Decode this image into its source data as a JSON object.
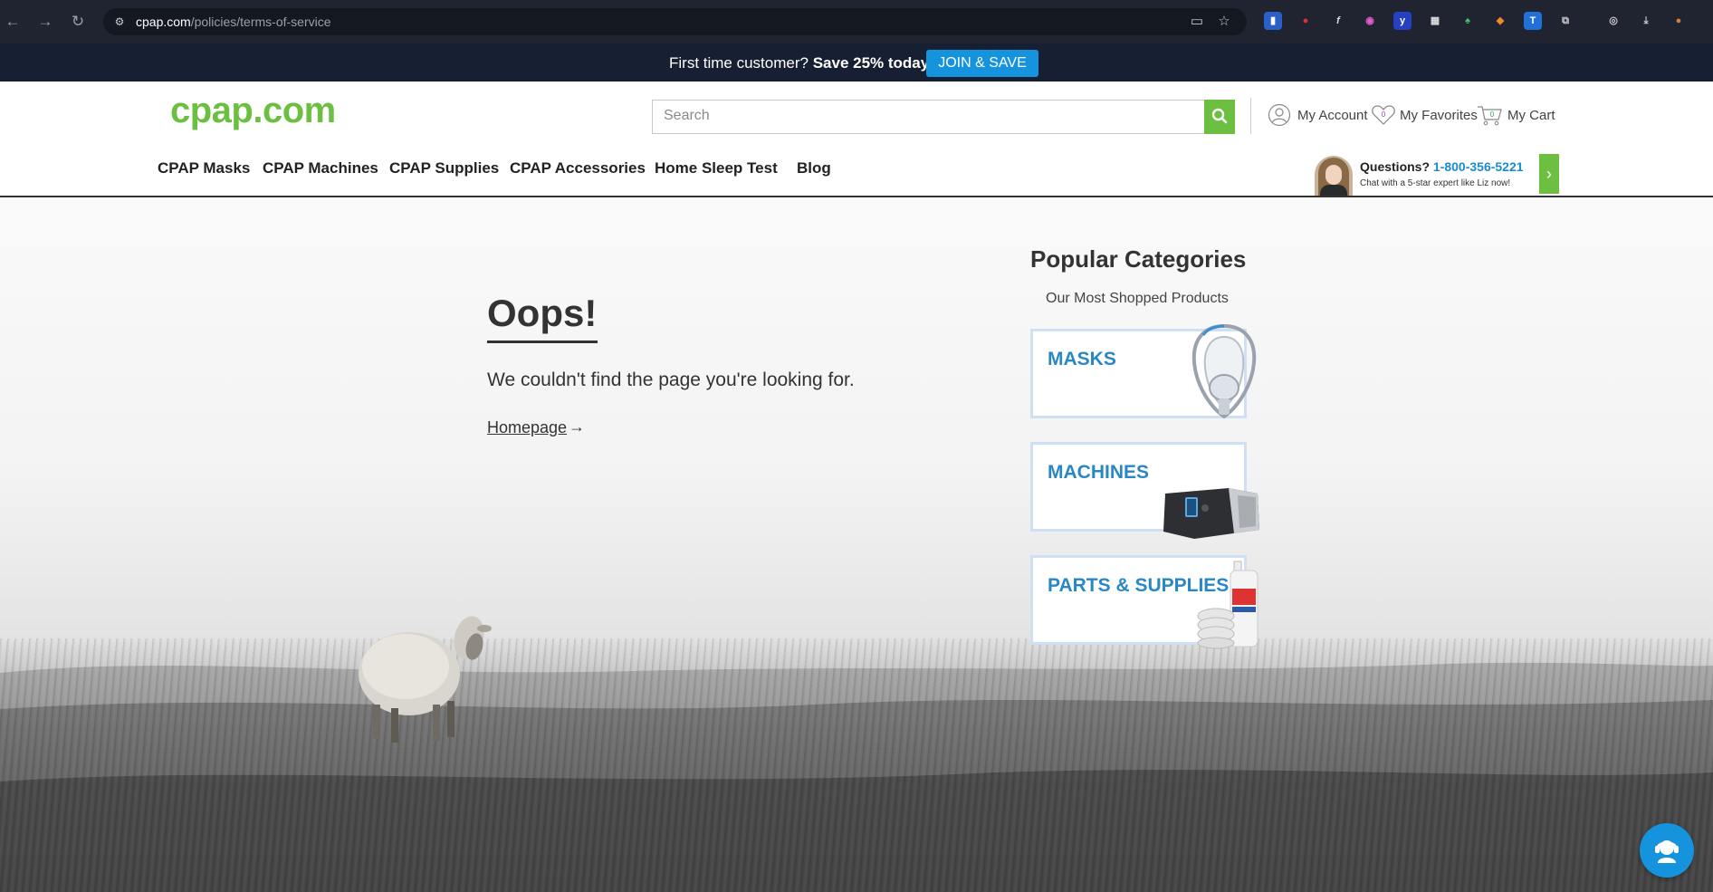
{
  "browser": {
    "url_host": "cpap.com",
    "url_path": "/policies/terms-of-service"
  },
  "promo": {
    "text_prefix": "First time customer? ",
    "text_bold": "Save 25% today!",
    "join_label": "JOIN & SAVE"
  },
  "header": {
    "logo": "cpap.com",
    "search_placeholder": "Search",
    "account_label": "My Account",
    "favorites_label": "My Favorites",
    "favorites_count": "0",
    "cart_label": "My Cart",
    "cart_count": "0"
  },
  "nav": {
    "items": [
      {
        "label": "CPAP Masks"
      },
      {
        "label": "CPAP Machines"
      },
      {
        "label": "CPAP Supplies"
      },
      {
        "label": "CPAP Accessories"
      },
      {
        "label": "Home Sleep Test"
      },
      {
        "label": "Blog"
      }
    ]
  },
  "help": {
    "question": "Questions?",
    "phone": "1-800-356-5221",
    "sub": "Chat with a 5-star expert like Liz now!"
  },
  "error": {
    "title": "Oops!",
    "message": "We couldn't find the page you're looking for.",
    "home_link": "Homepage",
    "arrow": "→"
  },
  "popular": {
    "title": "Popular Categories",
    "subtitle": "Our Most Shopped Products",
    "categories": [
      {
        "label": "MASKS"
      },
      {
        "label": "MACHINES"
      },
      {
        "label": "PARTS & SUPPLIES"
      }
    ]
  },
  "colors": {
    "brand_green": "#6cbf41",
    "link_blue": "#2a87c6",
    "promo_bg": "#172033",
    "join_btn": "#1593dd"
  }
}
